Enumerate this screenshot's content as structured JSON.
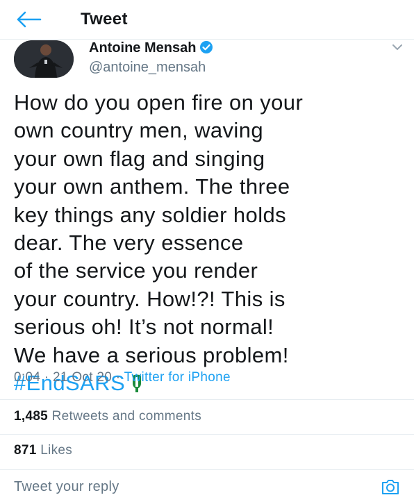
{
  "header": {
    "back_icon": "arrow-left-icon",
    "title": "Tweet"
  },
  "author": {
    "display_name": "Antoine Mensah",
    "handle": "@antoine_mensah",
    "verified_icon": "verified-badge-icon"
  },
  "tweet": {
    "lines": [
      "How do you open fire on your",
      "own country men, waving",
      "your own flag and singing",
      "your own anthem. The three",
      "key things any soldier holds",
      "dear. The very essence",
      "of the service you render",
      "your country. How!?! This is",
      "serious oh! It’s not normal!",
      "We have a serious problem!"
    ],
    "hashtag": "#EndSARS",
    "emoji_icon": "nigeria-flag-emoji",
    "time": "0:04",
    "date": "21 Oct 20",
    "separator": "·",
    "source": "Twitter for iPhone"
  },
  "stats": {
    "retweets_count": "1,485",
    "retweets_label": "Retweets and comments",
    "likes_count": "871",
    "likes_label": "Likes"
  },
  "reply": {
    "placeholder": "Tweet your reply",
    "camera_icon": "camera-icon"
  },
  "colors": {
    "accent": "#1da1f2",
    "secondary_text": "#657786",
    "primary_text": "#14171a",
    "divider": "#e6ecf0"
  }
}
